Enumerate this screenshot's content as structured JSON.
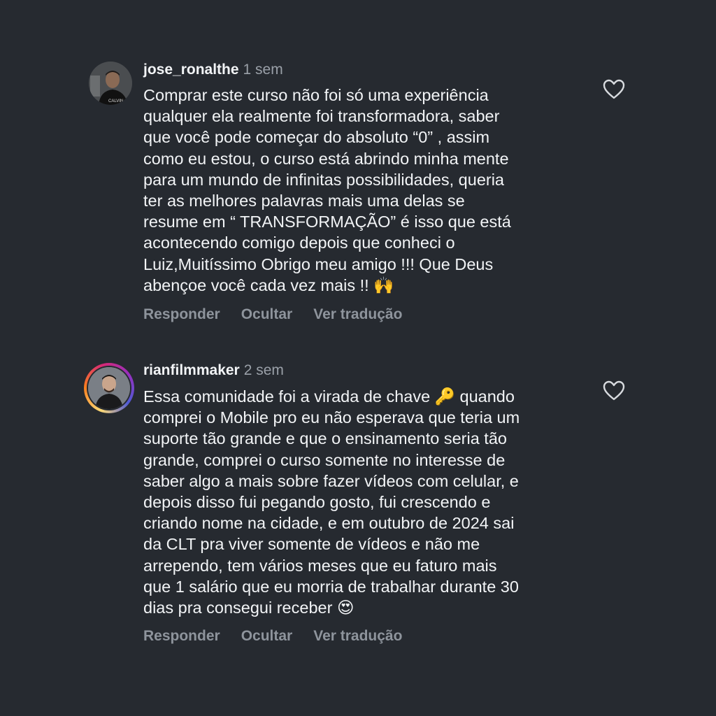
{
  "comments": [
    {
      "username": "jose_ronalthe",
      "time": "1 sem",
      "lines": [
        "Comprar este curso não foi só uma experiência",
        "qualquer ela realmente foi transformadora, saber",
        "que você pode começar do absoluto “0” , assim",
        "como eu estou, o curso está abrindo minha mente",
        "para um mundo de infinitas possibilidades, queria",
        "ter as melhores palavras mais uma delas se",
        "resume em “ TRANSFORMAÇÃO” é isso que está",
        "acontecendo comigo depois que conheci o",
        "Luiz,Muitíssimo Obrigo meu amigo !!! Que Deus",
        "abençoe você cada vez mais !! 🙌"
      ],
      "reply_label": "Responder",
      "hide_label": "Ocultar",
      "translate_label": "Ver tradução",
      "avatar_shirt_text": "CALVIN"
    },
    {
      "username": "rianfilmmaker",
      "time": "2 sem",
      "lines": [
        "Essa comunidade foi a virada de chave 🔑 quando",
        "comprei o Mobile pro eu não esperava que teria um",
        "suporte tão grande e que o ensinamento seria tão",
        "grande, comprei o curso somente no interesse de",
        "saber algo a mais sobre fazer vídeos com celular, e",
        "depois disso fui pegando gosto, fui crescendo e",
        "criando nome na cidade, e em outubro de 2024 sai",
        "da CLT pra viver somente de vídeos e não me",
        "arrependo, tem vários meses que eu faturo mais",
        "que 1 salário que eu morria de trabalhar durante 30",
        "dias pra consegui receber 😍"
      ],
      "reply_label": "Responder",
      "hide_label": "Ocultar",
      "translate_label": "Ver tradução"
    }
  ],
  "icons": {
    "like": "heart-outline-icon"
  },
  "colors": {
    "background": "#262a30",
    "text_primary": "#f2f4f6",
    "text_secondary": "#9aa0a8",
    "story_ring": [
      "#feda75",
      "#fa7e1e",
      "#d62976",
      "#962fbf",
      "#4f5bd5"
    ]
  }
}
